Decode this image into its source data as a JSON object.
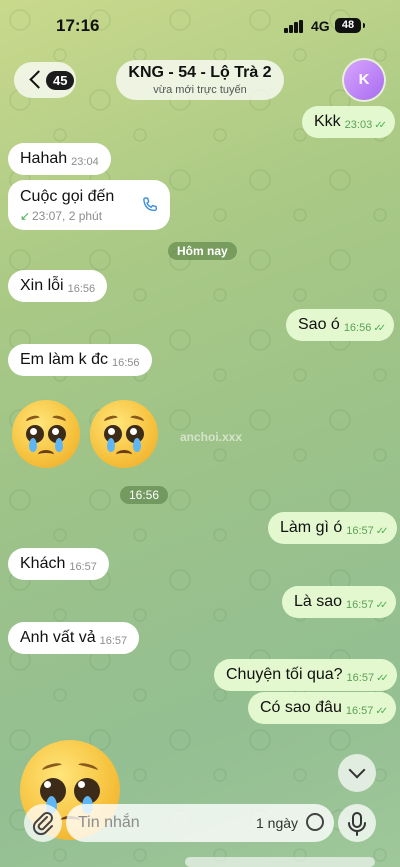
{
  "status_bar": {
    "time": "17:16",
    "network": "4G",
    "battery": "48"
  },
  "header": {
    "back_count": "45",
    "title": "KNG - 54 - Lộ Trà 2",
    "subtitle": "vừa mới trực tuyến",
    "avatar_letter": "K"
  },
  "messages": [
    {
      "text": "Kkk",
      "time": "23:03",
      "dir": "out"
    },
    {
      "text": "Hahah",
      "time": "23:04",
      "dir": "in"
    },
    {
      "call_label": "Cuộc gọi đến",
      "call_meta": "23:07, 2 phút",
      "dir": "in"
    },
    {
      "text": "Xin lỗi",
      "time": "16:56",
      "dir": "in"
    },
    {
      "text": "Sao ó",
      "time": "16:56",
      "dir": "out"
    },
    {
      "text": "Em làm k đc",
      "time": "16:56",
      "dir": "in"
    },
    {
      "text": "Làm gì ó",
      "time": "16:57",
      "dir": "out"
    },
    {
      "text": "Khách",
      "time": "16:57",
      "dir": "in"
    },
    {
      "text": "Là sao",
      "time": "16:57",
      "dir": "out"
    },
    {
      "text": "Anh vất vả",
      "time": "16:57",
      "dir": "in"
    },
    {
      "text": "Chuyện tối qua?",
      "time": "16:57",
      "dir": "out"
    },
    {
      "text": "Có sao đâu",
      "time": "16:57",
      "dir": "out"
    }
  ],
  "date_separator": "Hôm nay",
  "emoji_message_time": "16:56",
  "watermark": "anchoi.xxx",
  "composer": {
    "placeholder": "Tin nhắn",
    "timer_label": "1 ngày"
  },
  "colors": {
    "outgoing_bubble": "#e4f8cf",
    "incoming_bubble": "#ffffff",
    "read_ticks": "#4caf50"
  },
  "icons": [
    "back-chevron-icon",
    "phone-icon",
    "incoming-call-arrow-icon",
    "scroll-down-icon",
    "paperclip-icon",
    "timer-icon",
    "microphone-icon"
  ]
}
